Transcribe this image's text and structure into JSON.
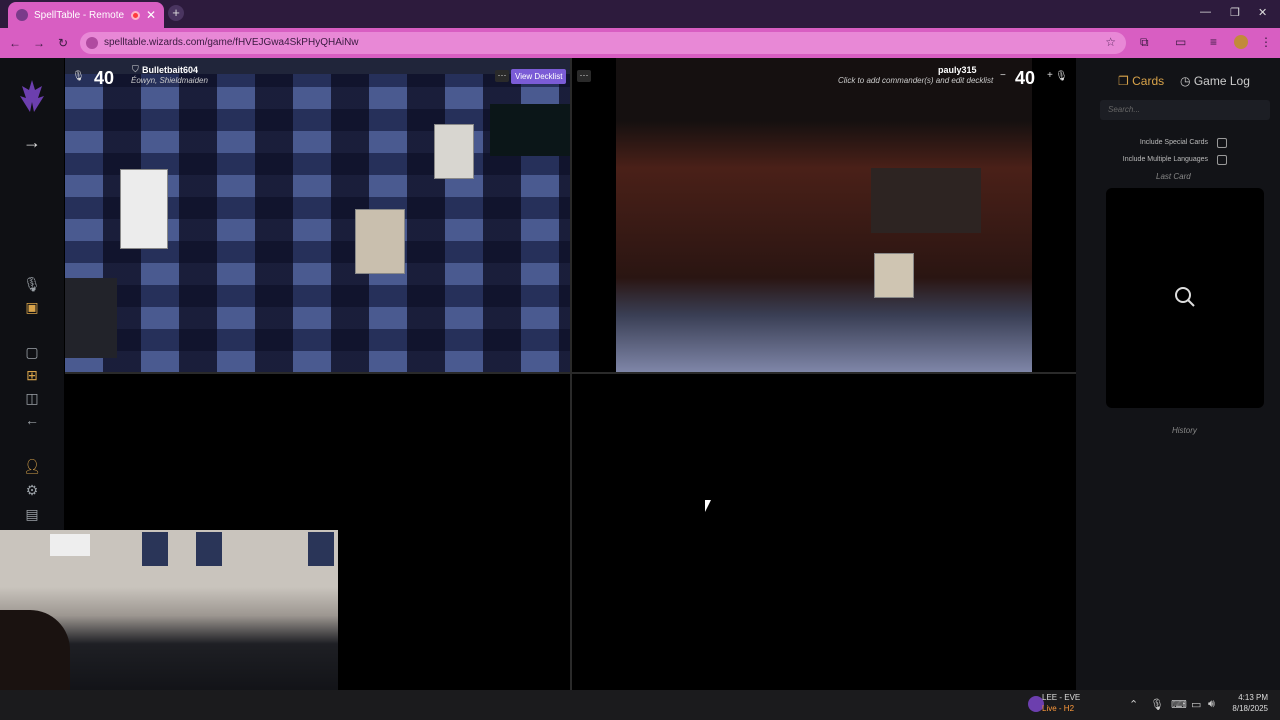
{
  "browser": {
    "tab_title": "SpellTable - Remote magic",
    "url": "spelltable.wizards.com/game/fHVEJGwa4SkPHyQHAiNw"
  },
  "players": [
    {
      "name": "Bulletbait604",
      "life": "40",
      "commander": "Éowyn, Shieldmaiden",
      "view_decklist": "View Decklist"
    },
    {
      "name": "pauly315",
      "life": "40",
      "commander_prompt": "Click to add commander(s) and edit decklist",
      "minus": "−",
      "plus": "+"
    }
  ],
  "sidebar": {
    "tabs": {
      "cards": "Cards",
      "gamelog": "Game Log"
    },
    "search_placeholder": "Search...",
    "include_special": "Include Special Cards",
    "include_multilang": "Include Multiple Languages",
    "last_card": "Last Card",
    "history": "History"
  },
  "taskbar": {
    "status_title": "LEE - EVE",
    "status_sub": "Live - H2",
    "time": "4:13 PM",
    "date": "8/18/2025"
  },
  "icons": {
    "back": "arrow-left",
    "forward": "arrow-right",
    "reload": "reload",
    "mic_muted": "mic-off",
    "camera": "camera",
    "settings": "gear",
    "search": "magnifier"
  },
  "colors": {
    "accent_browser": "#d85ec2",
    "accent_app": "#d8a34a",
    "decklist_button": "#7b5cd6"
  }
}
